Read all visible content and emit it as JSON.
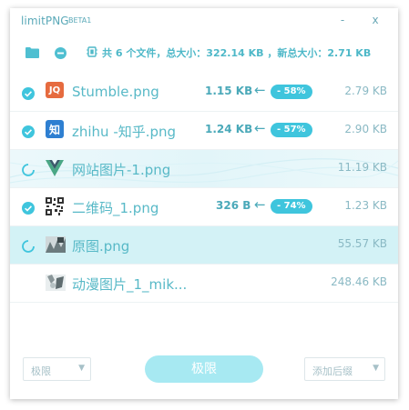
{
  "app": {
    "title": "limitPNG",
    "beta": "BETA1",
    "minimize": "-",
    "close": "x"
  },
  "toolbar": {
    "folder_icon": "folder-icon",
    "clear_icon": "minus-circle-icon",
    "summary_chip_icon": "chip-icon",
    "summary": "共 6 个文件，总大小：322.14 KB ，新总大小：2.71 KB"
  },
  "files": [
    {
      "status": "done",
      "thumb": "thumb-jq",
      "name": "Stumble.png",
      "new_size": "1.15 KB",
      "arrow": "←",
      "saving": "- 58%",
      "orig_size": "2.79 KB"
    },
    {
      "status": "done",
      "thumb": "thumb-zhihu",
      "name": "zhihu -知乎.png",
      "new_size": "1.24 KB",
      "arrow": "←",
      "saving": "- 57%",
      "orig_size": "2.90 KB"
    },
    {
      "status": "processing",
      "thumb": "thumb-vue",
      "name": "网站图片-1.png",
      "new_size": "",
      "arrow": "",
      "saving": "",
      "orig_size": "11.19 KB"
    },
    {
      "status": "done",
      "thumb": "thumb-qr",
      "name": "二维码_1.png",
      "new_size": "326 B",
      "arrow": "←",
      "saving": "- 74%",
      "orig_size": "1.23 KB"
    },
    {
      "status": "processing",
      "thumb": "thumb-photo",
      "name": "原图.png",
      "new_size": "",
      "arrow": "",
      "saving": "",
      "orig_size": "55.57 KB"
    },
    {
      "status": "pending",
      "thumb": "thumb-anime",
      "name": "动漫图片_1_mik...",
      "new_size": "",
      "arrow": "",
      "saving": "",
      "orig_size": "248.46 KB"
    }
  ],
  "bottom": {
    "mode_select": "极限",
    "primary_button": "极限",
    "suffix_select": "添加后缀"
  },
  "colors": {
    "accent": "#3fc5dd",
    "text": "#58b9c7",
    "active_row": "#d3f2f6",
    "button": "#a7e9f2"
  }
}
